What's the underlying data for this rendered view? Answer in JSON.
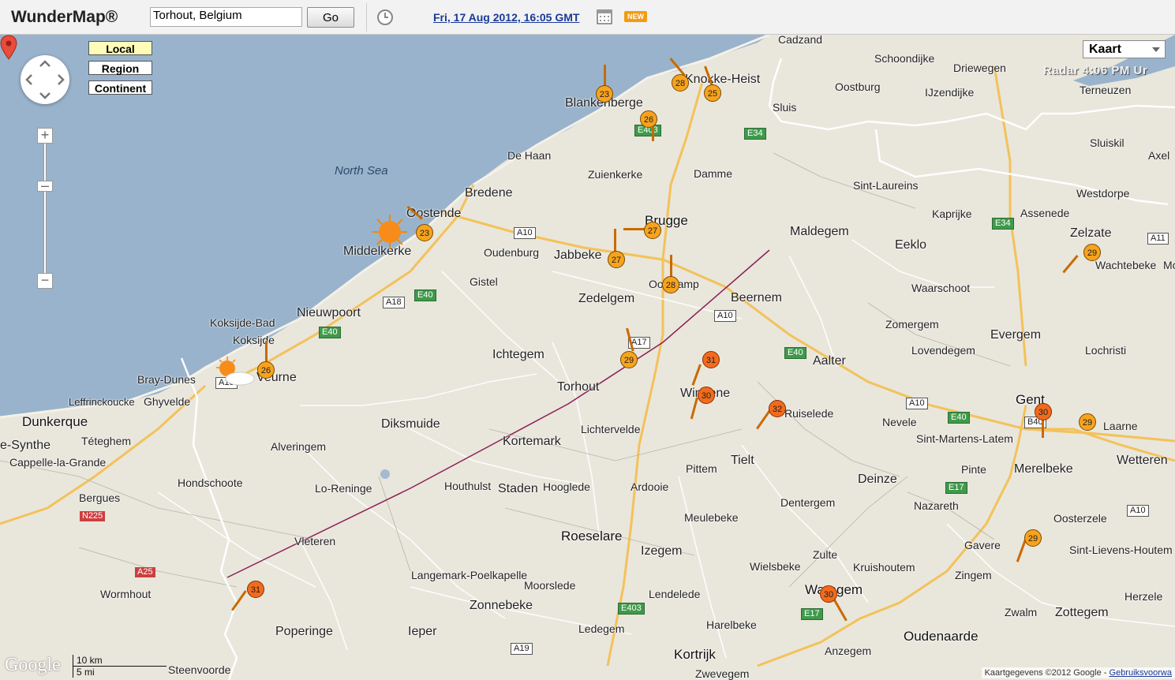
{
  "header": {
    "brand": "WunderMap®",
    "location_value": "Torhout, Belgium",
    "go_label": "Go",
    "datetime": "Fri, 17 Aug 2012, 16:05 GMT",
    "new_badge": "NEW"
  },
  "controls": {
    "scale_local": "Local",
    "scale_region": "Region",
    "scale_continent": "Continent",
    "zoom_in": "+",
    "zoom_out": "−",
    "map_type": "Kaart",
    "radar_time": "Radar  4:06 PM Ur"
  },
  "map": {
    "sea_label": "North Sea",
    "places": [
      {
        "name": "Cadzand"
      },
      {
        "name": "Schoondijke"
      },
      {
        "name": "Driewegen"
      },
      {
        "name": "Blankenberge"
      },
      {
        "name": "Knokke-Heist"
      },
      {
        "name": "Oostburg"
      },
      {
        "name": "IJzendijke"
      },
      {
        "name": "Terneuzen"
      },
      {
        "name": "Sluis"
      },
      {
        "name": "De Haan"
      },
      {
        "name": "Zuienkerke"
      },
      {
        "name": "Damme"
      },
      {
        "name": "Sluiskil"
      },
      {
        "name": "Axel"
      },
      {
        "name": "Sint-Laureins"
      },
      {
        "name": "Bredene"
      },
      {
        "name": "Westdorpe"
      },
      {
        "name": "Oostende"
      },
      {
        "name": "Brugge"
      },
      {
        "name": "Kaprijke"
      },
      {
        "name": "Assenede"
      },
      {
        "name": "Zelzate"
      },
      {
        "name": "Maldegem"
      },
      {
        "name": "Middelkerke"
      },
      {
        "name": "Oudenburg"
      },
      {
        "name": "Jabbeke"
      },
      {
        "name": "Eeklo"
      },
      {
        "name": "Wachtebeke"
      },
      {
        "name": "Gistel"
      },
      {
        "name": "Oostkamp"
      },
      {
        "name": "Waarschoot"
      },
      {
        "name": "Zedelgem"
      },
      {
        "name": "Beernem"
      },
      {
        "name": "Nieuwpoort"
      },
      {
        "name": "Koksijde-Bad"
      },
      {
        "name": "Zomergem"
      },
      {
        "name": "Koksijde"
      },
      {
        "name": "Evergem"
      },
      {
        "name": "Lovendegem"
      },
      {
        "name": "Lochristi"
      },
      {
        "name": "Ichtegem"
      },
      {
        "name": "Aalter"
      },
      {
        "name": "Bray-Dunes"
      },
      {
        "name": "Veurne"
      },
      {
        "name": "Torhout"
      },
      {
        "name": "Wingene"
      },
      {
        "name": "Leffrinckoucke"
      },
      {
        "name": "Ghyvelde"
      },
      {
        "name": "Dunkerque"
      },
      {
        "name": "Diksmuide"
      },
      {
        "name": "Ruiselede"
      },
      {
        "name": "Nevele"
      },
      {
        "name": "Gent"
      },
      {
        "name": "Lichtervelde"
      },
      {
        "name": "Téteghem"
      },
      {
        "name": "Sint-Martens-Latem"
      },
      {
        "name": "Laarne"
      },
      {
        "name": "e-Synthe"
      },
      {
        "name": "Kortemark"
      },
      {
        "name": "Alveringem"
      },
      {
        "name": "Cappelle-la-Grande"
      },
      {
        "name": "Tielt"
      },
      {
        "name": "Wetteren"
      },
      {
        "name": "Pittem"
      },
      {
        "name": "Pinte"
      },
      {
        "name": "Merelbeke"
      },
      {
        "name": "Hondschoote"
      },
      {
        "name": "Houthulst"
      },
      {
        "name": "Staden"
      },
      {
        "name": "Hooglede"
      },
      {
        "name": "Deinze"
      },
      {
        "name": "Lo-Reninge"
      },
      {
        "name": "Ardooie"
      },
      {
        "name": "Bergues"
      },
      {
        "name": "Dentergem"
      },
      {
        "name": "Nazareth"
      },
      {
        "name": "Meulebeke"
      },
      {
        "name": "Oosterzele"
      },
      {
        "name": "Roeselare"
      },
      {
        "name": "Vleteren"
      },
      {
        "name": "Gavere"
      },
      {
        "name": "Izegem"
      },
      {
        "name": "Zulte"
      },
      {
        "name": "Sint-Lievens-Houtem"
      },
      {
        "name": "Langemark-Poelkapelle"
      },
      {
        "name": "Wielsbeke"
      },
      {
        "name": "Kruishoutem"
      },
      {
        "name": "Zingem"
      },
      {
        "name": "Wormhout"
      },
      {
        "name": "Moorslede"
      },
      {
        "name": "Herzele"
      },
      {
        "name": "Lendelede"
      },
      {
        "name": "Waregem"
      },
      {
        "name": "Zonnebeke"
      },
      {
        "name": "Zwalm"
      },
      {
        "name": "Zottegem"
      },
      {
        "name": "Poperinge"
      },
      {
        "name": "Ieper"
      },
      {
        "name": "Harelbeke"
      },
      {
        "name": "Ledegem"
      },
      {
        "name": "Oudenaarde"
      },
      {
        "name": "Anzegem"
      },
      {
        "name": "Kortrijk"
      },
      {
        "name": "Steenvoorde"
      },
      {
        "name": "Zwevegem"
      },
      {
        "name": "Mo"
      }
    ],
    "roads": [
      "A10",
      "E40",
      "A18",
      "E40",
      "E403",
      "E34",
      "E34",
      "A10",
      "A11",
      "E40",
      "A17",
      "A10",
      "E40",
      "A10",
      "B40",
      "E17",
      "A10",
      "N225",
      "A25",
      "E403",
      "E17",
      "A19",
      "A18"
    ],
    "stations": [
      "23",
      "28",
      "25",
      "26",
      "23",
      "27",
      "27",
      "28",
      "29",
      "26",
      "29",
      "31",
      "30",
      "32",
      "30",
      "29",
      "29",
      "31",
      "30"
    ],
    "marker_label": "Torhout"
  },
  "footer": {
    "google": "Google",
    "scale_km": "10 km",
    "scale_mi": "5 mi",
    "copyright": "Kaartgegevens ©2012 Google - ",
    "terms_link": "Gebruiksvoorwa"
  }
}
